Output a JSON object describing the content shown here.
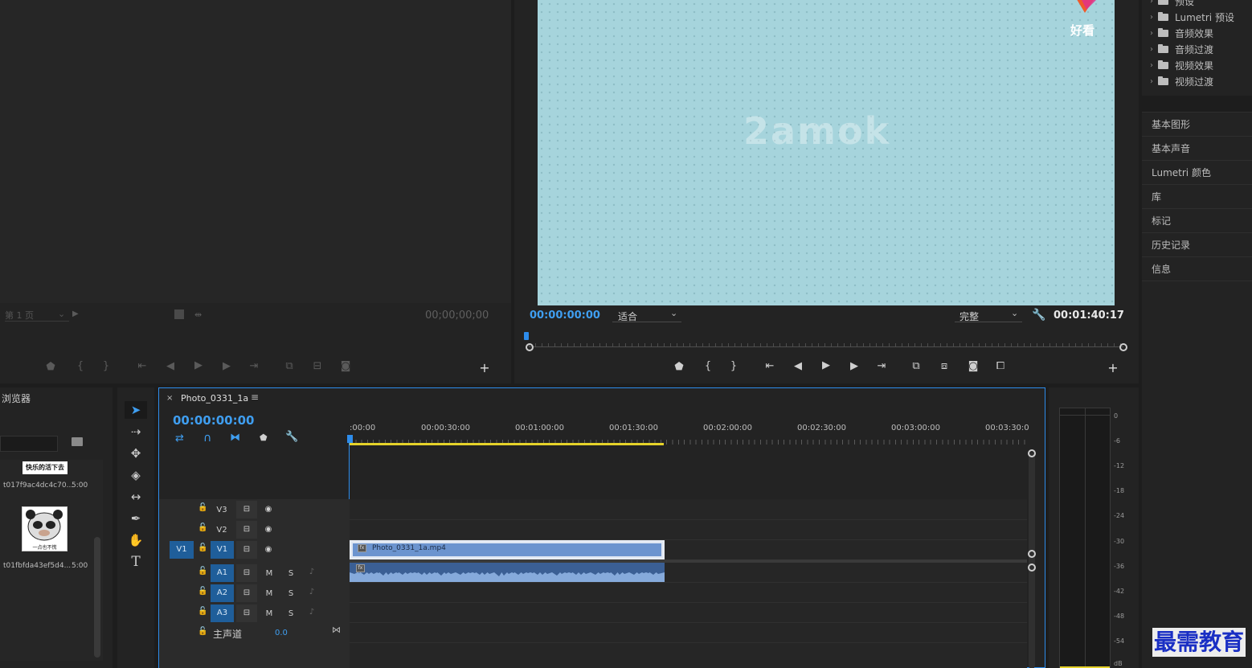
{
  "source_monitor": {
    "page_select": "第 1 页",
    "timecode": "00;00;00;00"
  },
  "program_monitor": {
    "timecode": "00:00:00:00",
    "fit_select": "适合",
    "quality_select": "完整",
    "duration": "00:01:40:17",
    "watermark_text": "2amok",
    "logo_text": "好看"
  },
  "effects_tree": {
    "items": [
      {
        "label": "预设"
      },
      {
        "label": "Lumetri 预设"
      },
      {
        "label": "音频效果"
      },
      {
        "label": "音频过渡"
      },
      {
        "label": "视频效果"
      },
      {
        "label": "视频过渡"
      }
    ]
  },
  "side_panels": [
    "基本图形",
    "基本声音",
    "Lumetri 颜色",
    "库",
    "标记",
    "历史记录",
    "信息"
  ],
  "project": {
    "title": "浏览器",
    "items": [
      {
        "name": "t017f9ac4dc4c70...",
        "duration": "5:00",
        "thumb_caption": "快乐的活下去"
      },
      {
        "name": "t01fbfda43ef5d4...",
        "duration": "5:00",
        "thumb_caption": "一点也不慌"
      }
    ]
  },
  "timeline": {
    "sequence_name": "Photo_0331_1a",
    "timecode": "00:00:00:00",
    "ruler": [
      ":00:00",
      "00:00:30:00",
      "00:01:00:00",
      "00:01:30:00",
      "00:02:00:00",
      "00:02:30:00",
      "00:03:00:00",
      "00:03:30:0"
    ],
    "video_tracks": [
      "V3",
      "V2",
      "V1"
    ],
    "audio_tracks": [
      "A1",
      "A2",
      "A3"
    ],
    "source_patch_video": "V1",
    "mute_label": "M",
    "solo_label": "S",
    "master_label": "主声道",
    "master_value": "0.0",
    "video_clip": "Photo_0331_1a.mp4",
    "fx_badge": "fx"
  },
  "meter": {
    "db_labels": [
      "0",
      "-6",
      "-12",
      "-18",
      "-24",
      "-30",
      "-36",
      "-42",
      "-48",
      "-54",
      "dB"
    ]
  },
  "brand_watermark": "最需教育",
  "colors": {
    "accent_blue": "#2d8ceb",
    "timecode_blue": "#3f9ef0",
    "clip_blue": "#6c94cf",
    "playhead_yellow": "#e5d22a"
  }
}
